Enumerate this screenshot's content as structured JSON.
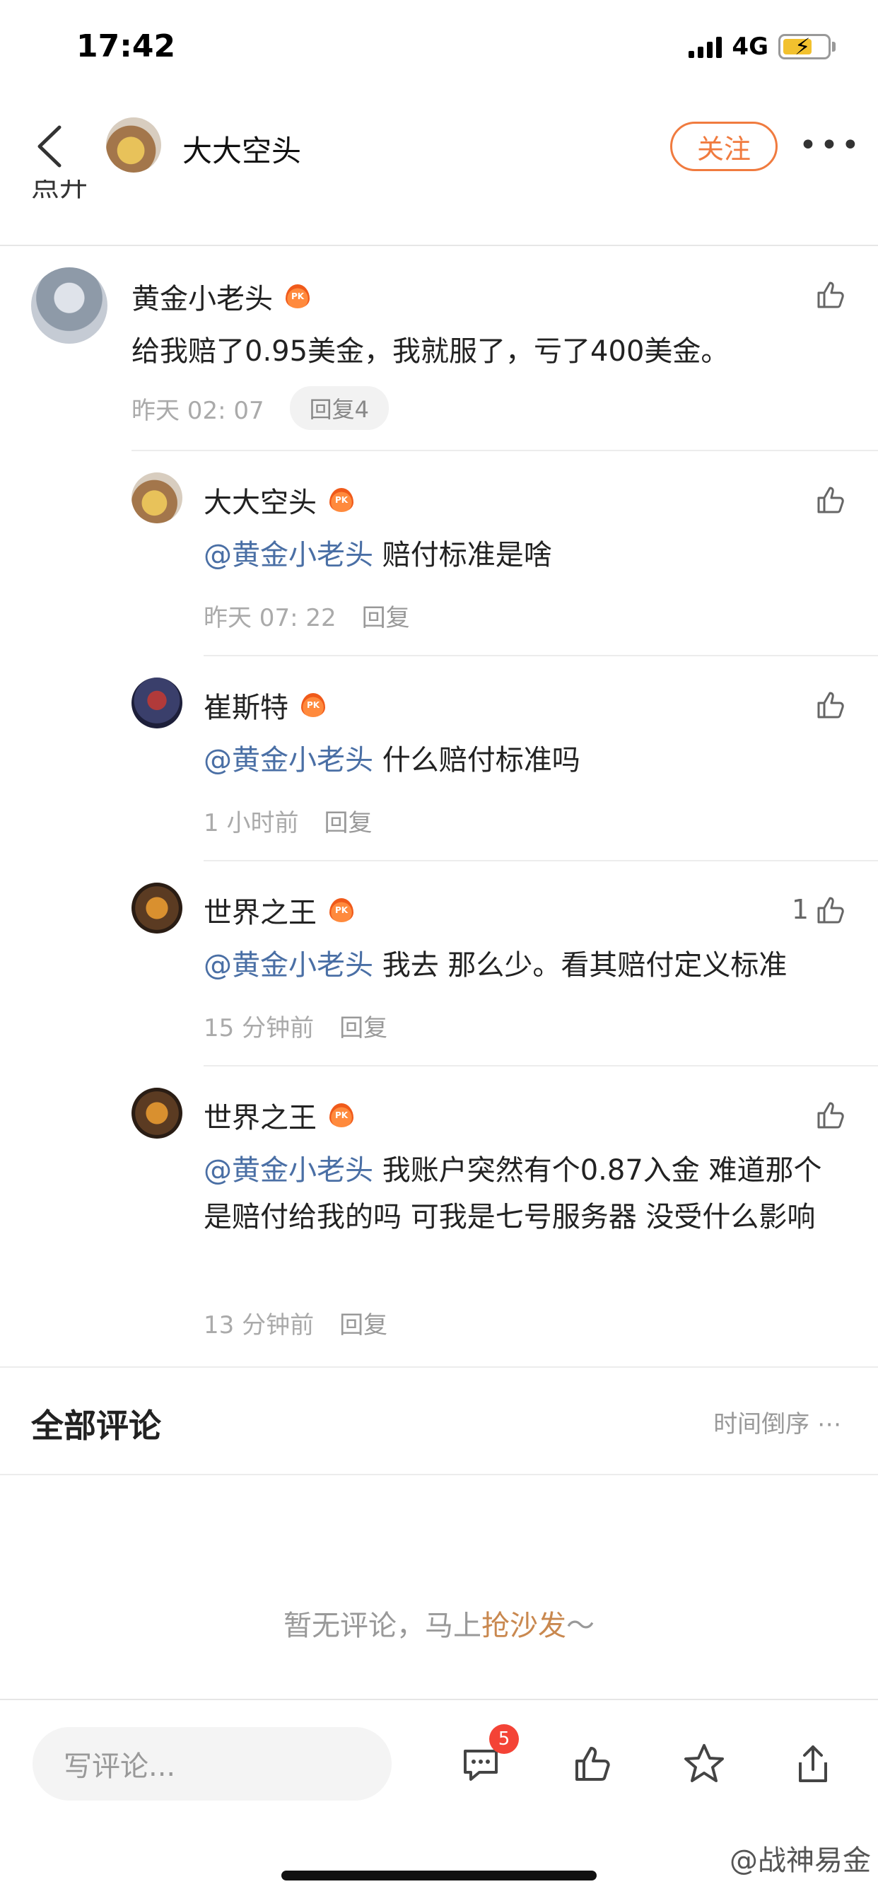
{
  "status_bar": {
    "time": "17:42",
    "network": "4G",
    "battery_color": "#f2c12e"
  },
  "header": {
    "author_name": "大大空头",
    "follow_label": "关注",
    "more_label": "•••"
  },
  "clipped_text": "点开",
  "main_comment": {
    "username": "黄金小老头",
    "text": "给我赔了0.95美金，我就服了，亏了400美金。",
    "time": "昨天 02: 07",
    "reply_count_label": "回复4"
  },
  "replies": [
    {
      "username": "大大空头",
      "mention": "@黄金小老头",
      "text": " 赔付标准是啥",
      "time": "昨天 07: 22",
      "reply_label": "回复",
      "likes": ""
    },
    {
      "username": "崔斯特",
      "mention": "@黄金小老头",
      "text": " 什么赔付标准吗",
      "time": "1 小时前",
      "reply_label": "回复",
      "likes": ""
    },
    {
      "username": "世界之王",
      "mention": "@黄金小老头",
      "text": " 我去 那么少。看其赔付定义标准",
      "time": "15 分钟前",
      "reply_label": "回复",
      "likes": "1"
    },
    {
      "username": "世界之王",
      "mention": "@黄金小老头",
      "text": " 我账户突然有个0.87入金 难道那个是赔付给我的吗 可我是七号服务器 没受什么影响",
      "time": "13 分钟前",
      "reply_label": "回复",
      "likes": ""
    }
  ],
  "all_comments": {
    "title": "全部评论",
    "sort_label": "时间倒序 ⋯"
  },
  "empty_state": {
    "prefix": "暂无评论，马上",
    "accent": "抢沙发",
    "suffix": "～"
  },
  "bottom_bar": {
    "input_placeholder": "写评论...",
    "comment_badge": "5"
  },
  "watermark": "@战神易金",
  "colors": {
    "accent": "#f07b3f",
    "mention": "#4a6fa5",
    "badge": "#f44336"
  }
}
